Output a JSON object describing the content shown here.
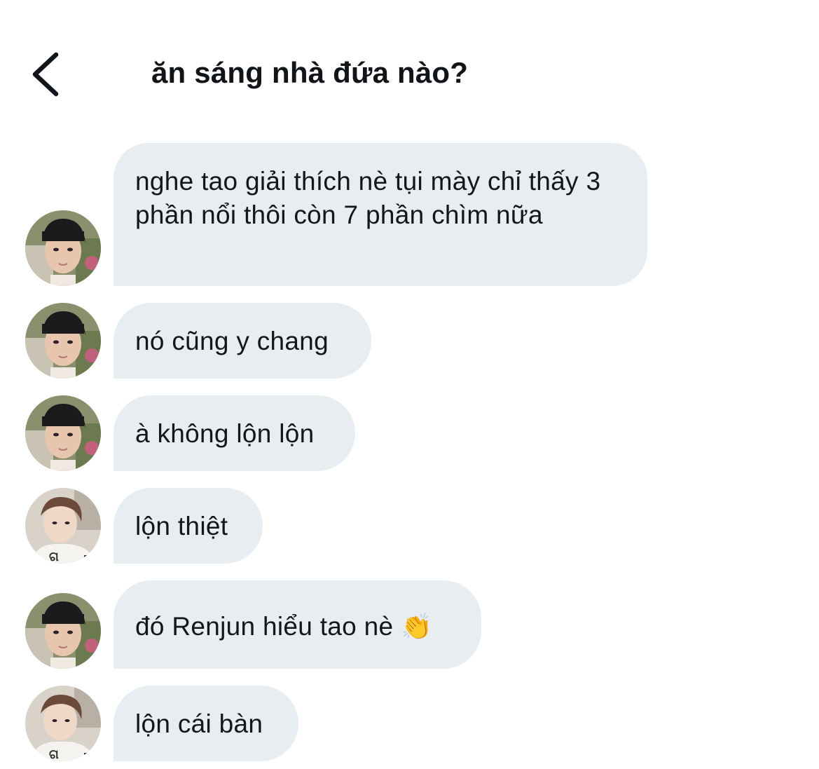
{
  "header": {
    "back_icon": "chevron-left-icon",
    "title": "ăn sáng nhà đứa nào?"
  },
  "messages": [
    {
      "sender": "avatar-a",
      "text": "nghe tao giải thích nè tụi mày chỉ thấy 3 phần nổi thôi còn 7 phần chìm nữa"
    },
    {
      "sender": "avatar-a",
      "text": "nó cũng y chang"
    },
    {
      "sender": "avatar-a",
      "text": "à không lộn lộn"
    },
    {
      "sender": "avatar-b",
      "text": "lộn thiệt"
    },
    {
      "sender": "avatar-a",
      "text": "đó Renjun hiểu tao nè",
      "emoji": "👏"
    },
    {
      "sender": "avatar-b",
      "text": "lộn cái bàn"
    }
  ],
  "colors": {
    "bubble_bg": "#e8edf1",
    "text": "#14171a",
    "background": "#ffffff"
  }
}
